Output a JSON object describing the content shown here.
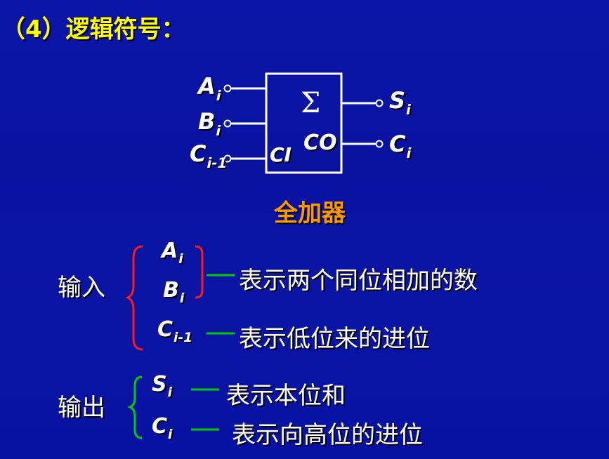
{
  "slide": {
    "title": "（4）逻辑符号：",
    "caption": "全加器",
    "colors": {
      "background": "#0b14a6",
      "title": "#ffff00",
      "caption": "#ff9900",
      "lines": "#ffffff",
      "red_brace": "#ff0000",
      "green": "#00cc00"
    }
  },
  "symbol": {
    "sigma": "Σ",
    "ci_label": "CI",
    "co_label": "CO",
    "inputs": [
      {
        "base": "A",
        "sub": "i"
      },
      {
        "base": "B",
        "sub": "i"
      },
      {
        "base": "C",
        "sub": "i-1"
      }
    ],
    "outputs": [
      {
        "base": "S",
        "sub": "i"
      },
      {
        "base": "C",
        "sub": "i"
      }
    ]
  },
  "legend": {
    "input_label": "输入",
    "output_label": "输出",
    "inputs": [
      {
        "base": "A",
        "sub": "i"
      },
      {
        "base": "B",
        "sub": "i"
      },
      {
        "base": "C",
        "sub": "i-1"
      }
    ],
    "outputs": [
      {
        "base": "S",
        "sub": "i"
      },
      {
        "base": "C",
        "sub": "i"
      }
    ],
    "desc_ab": "表示两个同位相加的数",
    "desc_c": "表示低位来的进位",
    "desc_s": "表示本位和",
    "desc_co": "表示向高位的进位"
  }
}
